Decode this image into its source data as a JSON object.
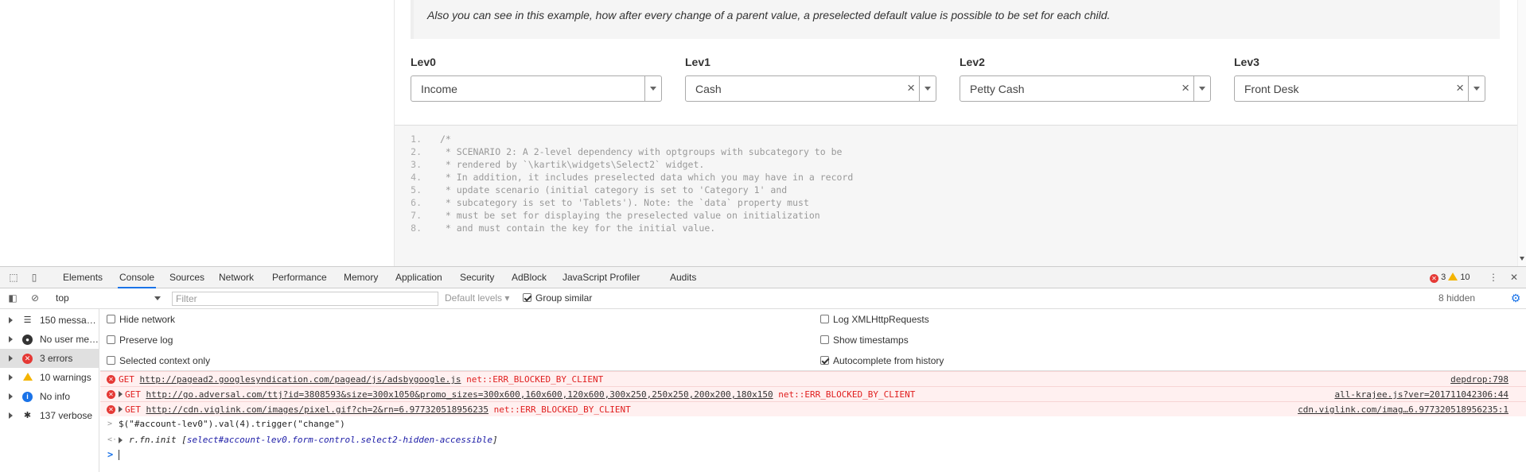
{
  "page": {
    "note": "Also you can see in this example, how after every change of a parent value, a preselected default value is possible to be set for each child.",
    "levels": [
      {
        "label": "Lev0",
        "value": "Income",
        "clearable": false
      },
      {
        "label": "Lev1",
        "value": "Cash",
        "clearable": true
      },
      {
        "label": "Lev2",
        "value": "Petty Cash",
        "clearable": true
      },
      {
        "label": "Lev3",
        "value": "Front Desk",
        "clearable": true
      }
    ],
    "clear_glyph": "×",
    "code_lines": [
      {
        "n": "1.",
        "t": "/*"
      },
      {
        "n": "2.",
        "t": " * SCENARIO 2: A 2-level dependency with optgroups with subcategory to be"
      },
      {
        "n": "3.",
        "t": " * rendered by `\\kartik\\widgets\\Select2` widget."
      },
      {
        "n": "4.",
        "t": " * In addition, it includes preselected data which you may have in a record"
      },
      {
        "n": "5.",
        "t": " * update scenario (initial category is set to 'Category 1' and"
      },
      {
        "n": "6.",
        "t": " * subcategory is set to 'Tablets'). Note: the `data` property must"
      },
      {
        "n": "7.",
        "t": " * must be set for displaying the preselected value on initialization"
      },
      {
        "n": "8.",
        "t": " * and must contain the key for the initial value."
      }
    ]
  },
  "devtools": {
    "tabs": [
      "Elements",
      "Console",
      "Sources",
      "Network",
      "Performance",
      "Memory",
      "Application",
      "Security",
      "AdBlock",
      "JavaScript Profiler",
      "Audits"
    ],
    "active_tab": "Console",
    "error_count": "3",
    "warning_count": "10",
    "toolbar": {
      "context": "top",
      "filter_placeholder": "Filter",
      "levels": "Default levels ▾",
      "group_similar": "Group similar",
      "hidden": "8 hidden"
    },
    "settings": {
      "hide_network": "Hide network",
      "preserve_log": "Preserve log",
      "selected_context_only": "Selected context only",
      "log_xhr": "Log XMLHttpRequests",
      "show_timestamps": "Show timestamps",
      "autocomplete": "Autocomplete from history"
    },
    "sidebar": [
      {
        "label": "150 messa…",
        "icon": "list-icon"
      },
      {
        "label": "No user me…",
        "icon": "user-icon"
      },
      {
        "label": "3 errors",
        "icon": "error-icon"
      },
      {
        "label": "10 warnings",
        "icon": "warning-icon"
      },
      {
        "label": "No info",
        "icon": "info-icon"
      },
      {
        "label": "137 verbose",
        "icon": "bug-icon"
      }
    ],
    "console": {
      "errors": [
        {
          "method": "GET",
          "url": "http://pagead2.googlesyndication.com/pagead/js/adsbygoogle.js",
          "status": "net::ERR_BLOCKED_BY_CLIENT",
          "source": "depdrop:798",
          "expandable": false
        },
        {
          "method": "GET",
          "url": "http://go.adversal.com/ttj?id=3808593&size=300x1050&promo_sizes=300x600,160x600,120x600,300x250,250x250,200x200,180x150",
          "status": "net::ERR_BLOCKED_BY_CLIENT",
          "source": "all-krajee.js?ver=201711042306:44",
          "expandable": true
        },
        {
          "method": "GET",
          "url": "http://cdn.viglink.com/images/pixel.gif?ch=2&rn=6.977320518956235",
          "status": "net::ERR_BLOCKED_BY_CLIENT",
          "source": "cdn.viglink.com/imag…6.977320518956235:1",
          "expandable": true
        }
      ],
      "command": "$(\"#account-lev0\").val(4).trigger(\"change\")",
      "result_prefix": "r.fn.init [",
      "result_obj": "select#account-lev0.form-control.select2-hidden-accessible",
      "result_suffix": "]"
    }
  }
}
